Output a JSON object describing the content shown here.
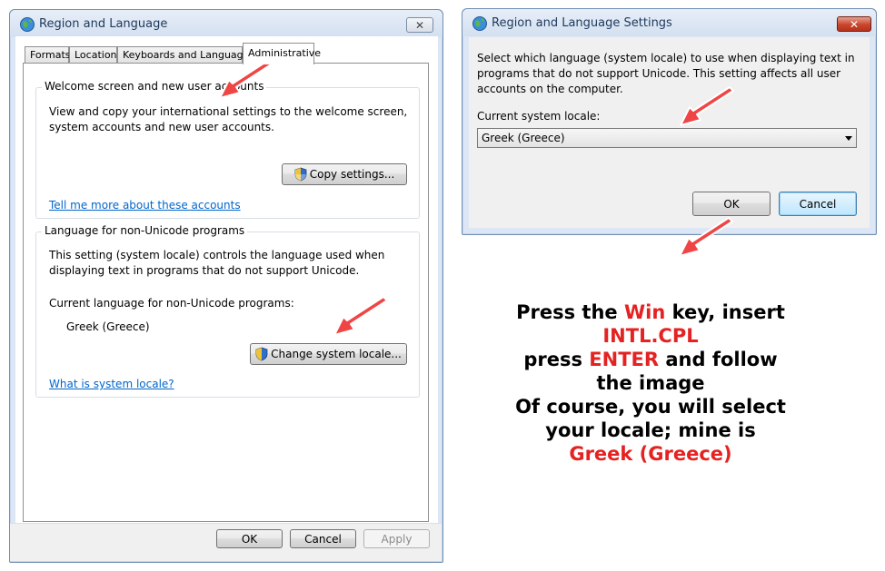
{
  "main_window": {
    "title": "Region and Language",
    "tabs": [
      "Formats",
      "Location",
      "Keyboards and Languages",
      "Administrative"
    ],
    "active_tab": "Administrative",
    "welcome_group": {
      "label": "Welcome screen and new user accounts",
      "description": "View and copy your international settings to the welcome screen, system accounts and new user accounts.",
      "copy_button": "Copy settings...",
      "link": "Tell me more about these accounts"
    },
    "nonunicode_group": {
      "label": "Language for non-Unicode programs",
      "description": "This setting (system locale) controls the language used when displaying text in programs that do not support Unicode.",
      "current_label": "Current language for non-Unicode programs:",
      "current_value": "Greek (Greece)",
      "change_button": "Change system locale...",
      "link": "What is system locale?"
    },
    "footer": {
      "ok": "OK",
      "cancel": "Cancel",
      "apply": "Apply"
    }
  },
  "settings_window": {
    "title": "Region and Language Settings",
    "description": "Select which language (system locale) to use when displaying text in programs that do not support Unicode. This setting affects all user accounts on the computer.",
    "locale_label": "Current system locale:",
    "locale_value": "Greek (Greece)",
    "ok": "OK",
    "cancel": "Cancel"
  },
  "instructions": {
    "l1_a": "Press the ",
    "l1_b": "Win",
    "l1_c": " key, insert",
    "l2": "INTL.CPL",
    "l3_a": "press ",
    "l3_b": "ENTER",
    "l3_c": " and follow",
    "l4": "the image",
    "l5": "Of course, you will select",
    "l6": "your locale; mine is",
    "l7": "Greek (Greece)"
  },
  "colors": {
    "highlight": "#e52222",
    "arrow": "#f04545",
    "link": "#0066cc"
  },
  "icons": [
    "globe-icon",
    "close-icon",
    "shield-icon",
    "dropdown-arrow-icon",
    "pointer-arrow-icon"
  ]
}
